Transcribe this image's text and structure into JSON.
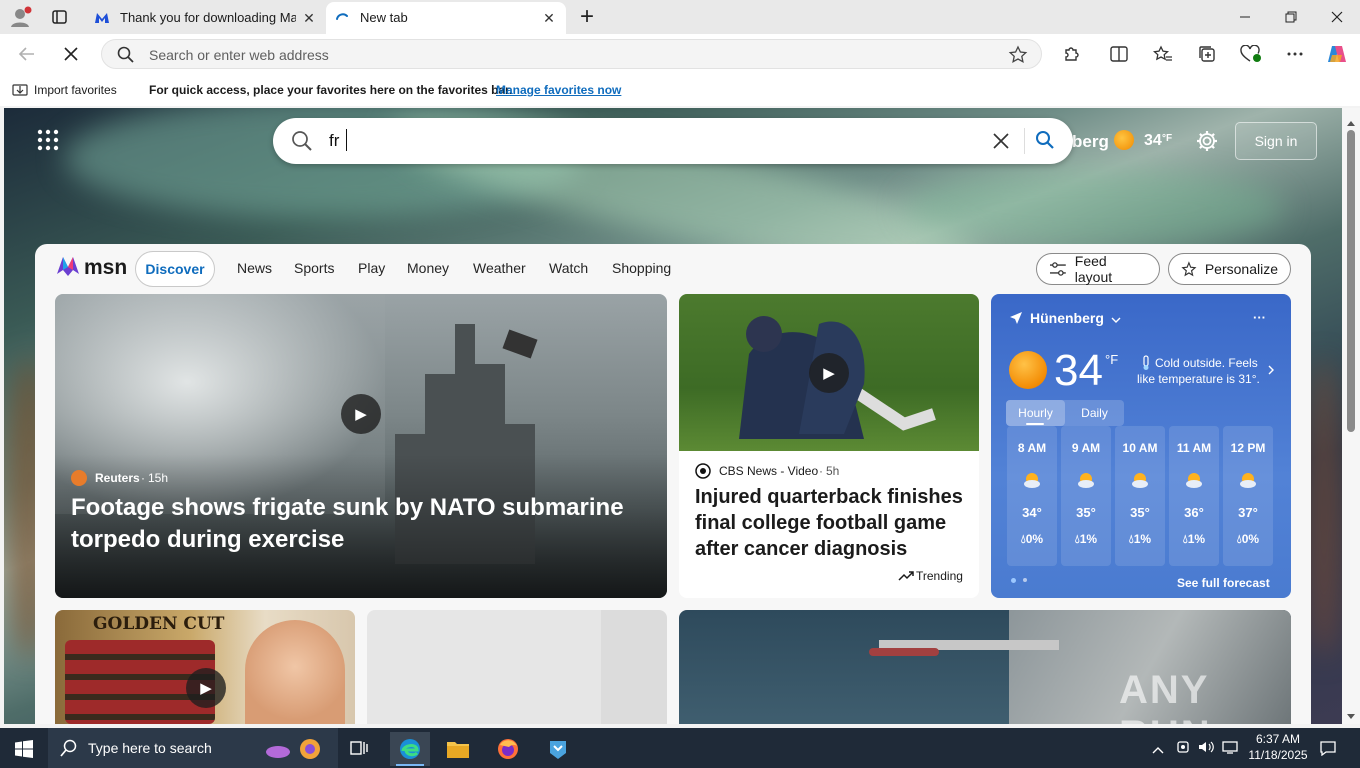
{
  "tabs": [
    {
      "title": "Thank you for downloading Malw",
      "close": "✕"
    },
    {
      "title": "New tab",
      "close": "✕"
    }
  ],
  "new_tab": "+",
  "address_bar": {
    "placeholder": "Search or enter web address"
  },
  "favorites_bar": {
    "import": "Import favorites",
    "message": "For quick access, place your favorites here on the favorites bar.",
    "manage_link": "Manage favorites now"
  },
  "search": {
    "value": "fr",
    "clear": "✕"
  },
  "header": {
    "location_partial": "berg",
    "temp": "34",
    "unit": "°F",
    "sign_in": "Sign in"
  },
  "msn": {
    "brand": "msn",
    "nav": [
      "Discover",
      "News",
      "Sports",
      "Play",
      "Money",
      "Weather",
      "Watch",
      "Shopping"
    ],
    "feed_layout": "Feed layout",
    "personalize": "Personalize"
  },
  "hero": {
    "source": "Reuters",
    "time": "15h",
    "headline": "Footage shows frigate sunk by NATO submarine torpedo during exercise"
  },
  "story2": {
    "source": "CBS News - Video",
    "time": "5h",
    "headline": "Injured quarterback finishes final college football game after cancer diagnosis",
    "trending": "Trending"
  },
  "weather": {
    "location": "Hünenberg",
    "menu": "···",
    "temp": "34",
    "unit": "°F",
    "message": "Cold outside. Feels like temperature is 31°.",
    "tabs": [
      "Hourly",
      "Daily"
    ],
    "hourly": [
      {
        "time": "8 AM",
        "temp": "34°",
        "precip": "0%"
      },
      {
        "time": "9 AM",
        "temp": "35°",
        "precip": "1%"
      },
      {
        "time": "10 AM",
        "temp": "35°",
        "precip": "1%"
      },
      {
        "time": "11 AM",
        "temp": "36°",
        "precip": "1%"
      },
      {
        "time": "12 PM",
        "temp": "37°",
        "precip": "0%"
      }
    ],
    "full_forecast": "See full forecast"
  },
  "promo": {
    "title": "GOLDEN CUT"
  },
  "watermark": "ANY RUN",
  "taskbar": {
    "search_placeholder": "Type here to search",
    "time": "6:37 AM",
    "date": "11/18/2025"
  },
  "colors": {
    "msn_blue": "#0f6cbd",
    "accent": "#0078d4"
  }
}
